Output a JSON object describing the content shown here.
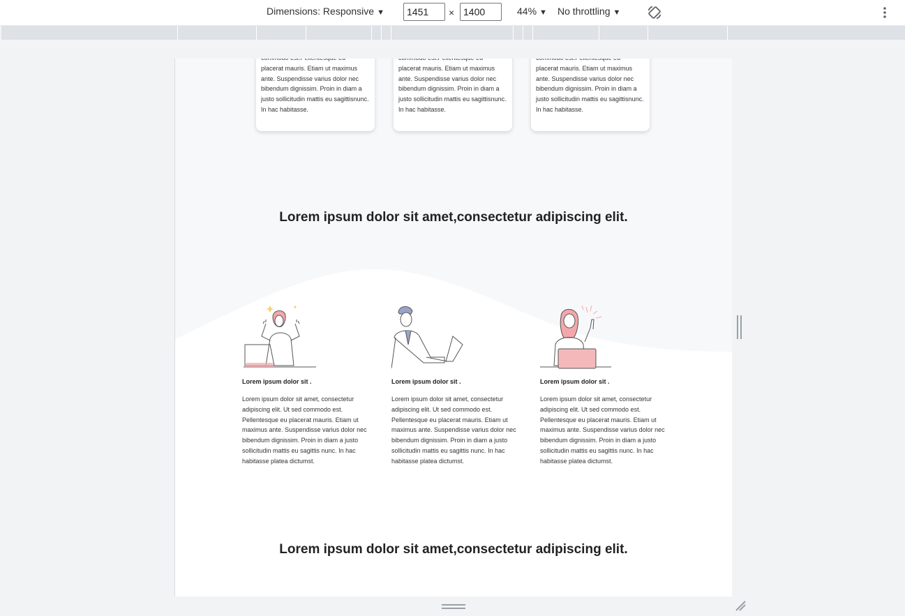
{
  "toolbar": {
    "dimensions_label": "Dimensions: Responsive",
    "width_value": "1451",
    "height_value": "1400",
    "times": "×",
    "zoom_label": "44%",
    "throttling_label": "No throttling",
    "caret": "▼"
  },
  "page": {
    "card_text": "commodo est.Pellentesque eu placerat mauris. Etiam ut maximus ante. Suspendisse varius dolor nec bibendum dignissim. Proin in diam a justo sollicitudin mattis eu sagittisnunc. In hac habitasse.",
    "cards": [
      {
        "text": "commodo est.Pellentesque eu placerat mauris. Etiam ut maximus ante. Suspendisse varius dolor nec bibendum dignissim. Proin in diam a justo sollicitudin mattis eu sagittisnunc. In hac habitasse."
      },
      {
        "text": "commodo est.Pellentesque eu placerat mauris. Etiam ut maximus ante. Suspendisse varius dolor nec bibendum dignissim. Proin in diam a justo sollicitudin mattis eu sagittisnunc. In hac habitasse."
      },
      {
        "text": "commodo est.Pellentesque eu placerat mauris. Etiam ut maximus ante. Suspendisse varius dolor nec bibendum dignissim. Proin in diam a justo sollicitudin mattis eu sagittisnunc. In hac habitasse."
      }
    ],
    "heading_1": "Lorem ipsum dolor sit amet,consectetur adipiscing elit.",
    "features": [
      {
        "title": "Lorem ipsum dolor sit .",
        "text": "Lorem ipsum dolor sit amet, consectetur adipiscing elit. Ut sed commodo est. Pellentesque eu placerat mauris. Etiam ut maximus ante. Suspendisse varius dolor nec bibendum dignissim. Proin in diam a justo sollicitudin mattis eu sagittis nunc. In hac habitasse platea dictumst."
      },
      {
        "title": "Lorem ipsum dolor sit .",
        "text": "Lorem ipsum dolor sit amet, consectetur adipiscing elit. Ut sed commodo est. Pellentesque eu placerat mauris. Etiam ut maximus ante. Suspendisse varius dolor nec bibendum dignissim. Proin in diam a justo sollicitudin mattis eu sagittis nunc. In hac habitasse platea dictumst."
      },
      {
        "title": "Lorem ipsum dolor sit .",
        "text": "Lorem ipsum dolor sit amet, consectetur adipiscing elit. Ut sed commodo est. Pellentesque eu placerat mauris. Etiam ut maximus ante. Suspendisse varius dolor nec bibendum dignissim. Proin in diam a justo sollicitudin mattis eu sagittis nunc. In hac habitasse platea dictumst."
      }
    ],
    "heading_2": "Lorem ipsum dolor sit amet,consectetur adipiscing elit."
  },
  "colors": {
    "accent_pink": "#f4a7ab",
    "section_bg": "#f7f8fa",
    "toolbar_bg": "#ffffff"
  },
  "icons": [
    "rotate-icon",
    "more-vertical-icon",
    "resize-corner-icon"
  ]
}
